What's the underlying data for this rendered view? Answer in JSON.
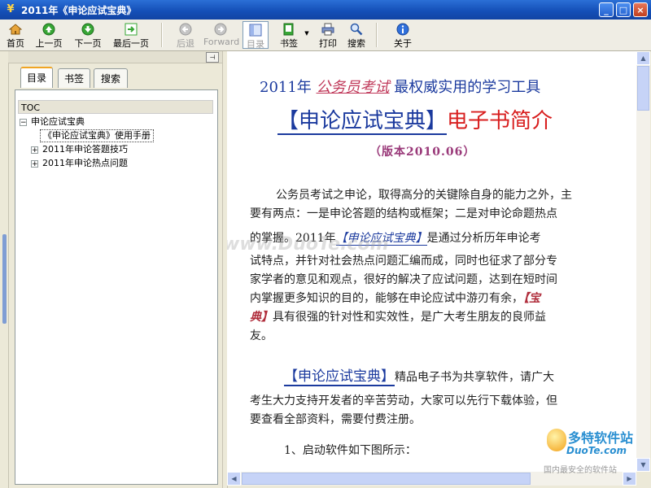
{
  "window": {
    "title": "2011年《申论应试宝典》",
    "min_label": "_",
    "max_label": "□",
    "close_label": "×"
  },
  "toolbar": {
    "home": "首页",
    "prev": "上一页",
    "next": "下一页",
    "last": "最后一页",
    "back": "后退",
    "forward": "Forward",
    "toc": "目录",
    "bookmark": "书签",
    "print": "打印",
    "search": "搜索",
    "about": "关于"
  },
  "left_panel": {
    "tabs": [
      "目录",
      "书签",
      "搜索"
    ],
    "tree_header": "TOC",
    "tree": [
      {
        "label": "申论应试宝典",
        "expander": "−"
      },
      {
        "label": "《申论应试宝典》使用手册",
        "expander": ""
      },
      {
        "label": "2011年申论答题技巧",
        "expander": "+"
      },
      {
        "label": "2011年申论热点问题",
        "expander": "+"
      }
    ]
  },
  "document": {
    "subtitle_pre": "2011年",
    "subtitle_em": "公务员考试",
    "subtitle_post": "最权威实用的学习工具",
    "title_a": "【申论应试宝典】",
    "title_b": "电子书简介",
    "version": "（版本2010.06）",
    "p1_l1": "公务员考试之申论，取得高分的关键除自身的能力之外，主",
    "p1_l2": "要有两点：一是申论答题的结构或框架；二是对申论命题热点",
    "p1_l3_a": "的掌握。2011年",
    "p1_l3_link": "【申论应试宝典】",
    "p1_l3_b": "是通过分析历年申论考",
    "p1_l4": "试特点，并针对社会热点问题汇编而成，同时也征求了部分专",
    "p1_l5": "家学者的意见和观点，很好的解决了应试问题，达到在短时间",
    "p1_l6_a": "内掌握更多知识的目的，能够在申论应试中游刃有余，",
    "p1_l6_link": "【宝",
    "p1_l7_link": "典】",
    "p1_l7_b": "具有很强的针对性和实效性，是广大考生朋友的良师益",
    "p1_l8": "友。",
    "p2_l1_link": "【申论应试宝典】",
    "p2_l1_b": "精品电子书为共享软件，请广大",
    "p2_l2": "考生大力支持开发者的辛苦劳动，大家可以先行下载体验，但",
    "p2_l3": "要查看全部资料，需要付费注册。",
    "p3": "1、启动软件如下图所示：",
    "watermark": "www.DuoTe.com"
  },
  "brand": {
    "name": "多特软件站",
    "domain": "DuoTe.com",
    "slogan": "国内最安全的软件站"
  },
  "colors": {
    "titlebar": "#1550b8",
    "heading_blue": "#1b3a9e",
    "heading_red": "#d81e1e",
    "accent_pink": "#c0395a"
  }
}
